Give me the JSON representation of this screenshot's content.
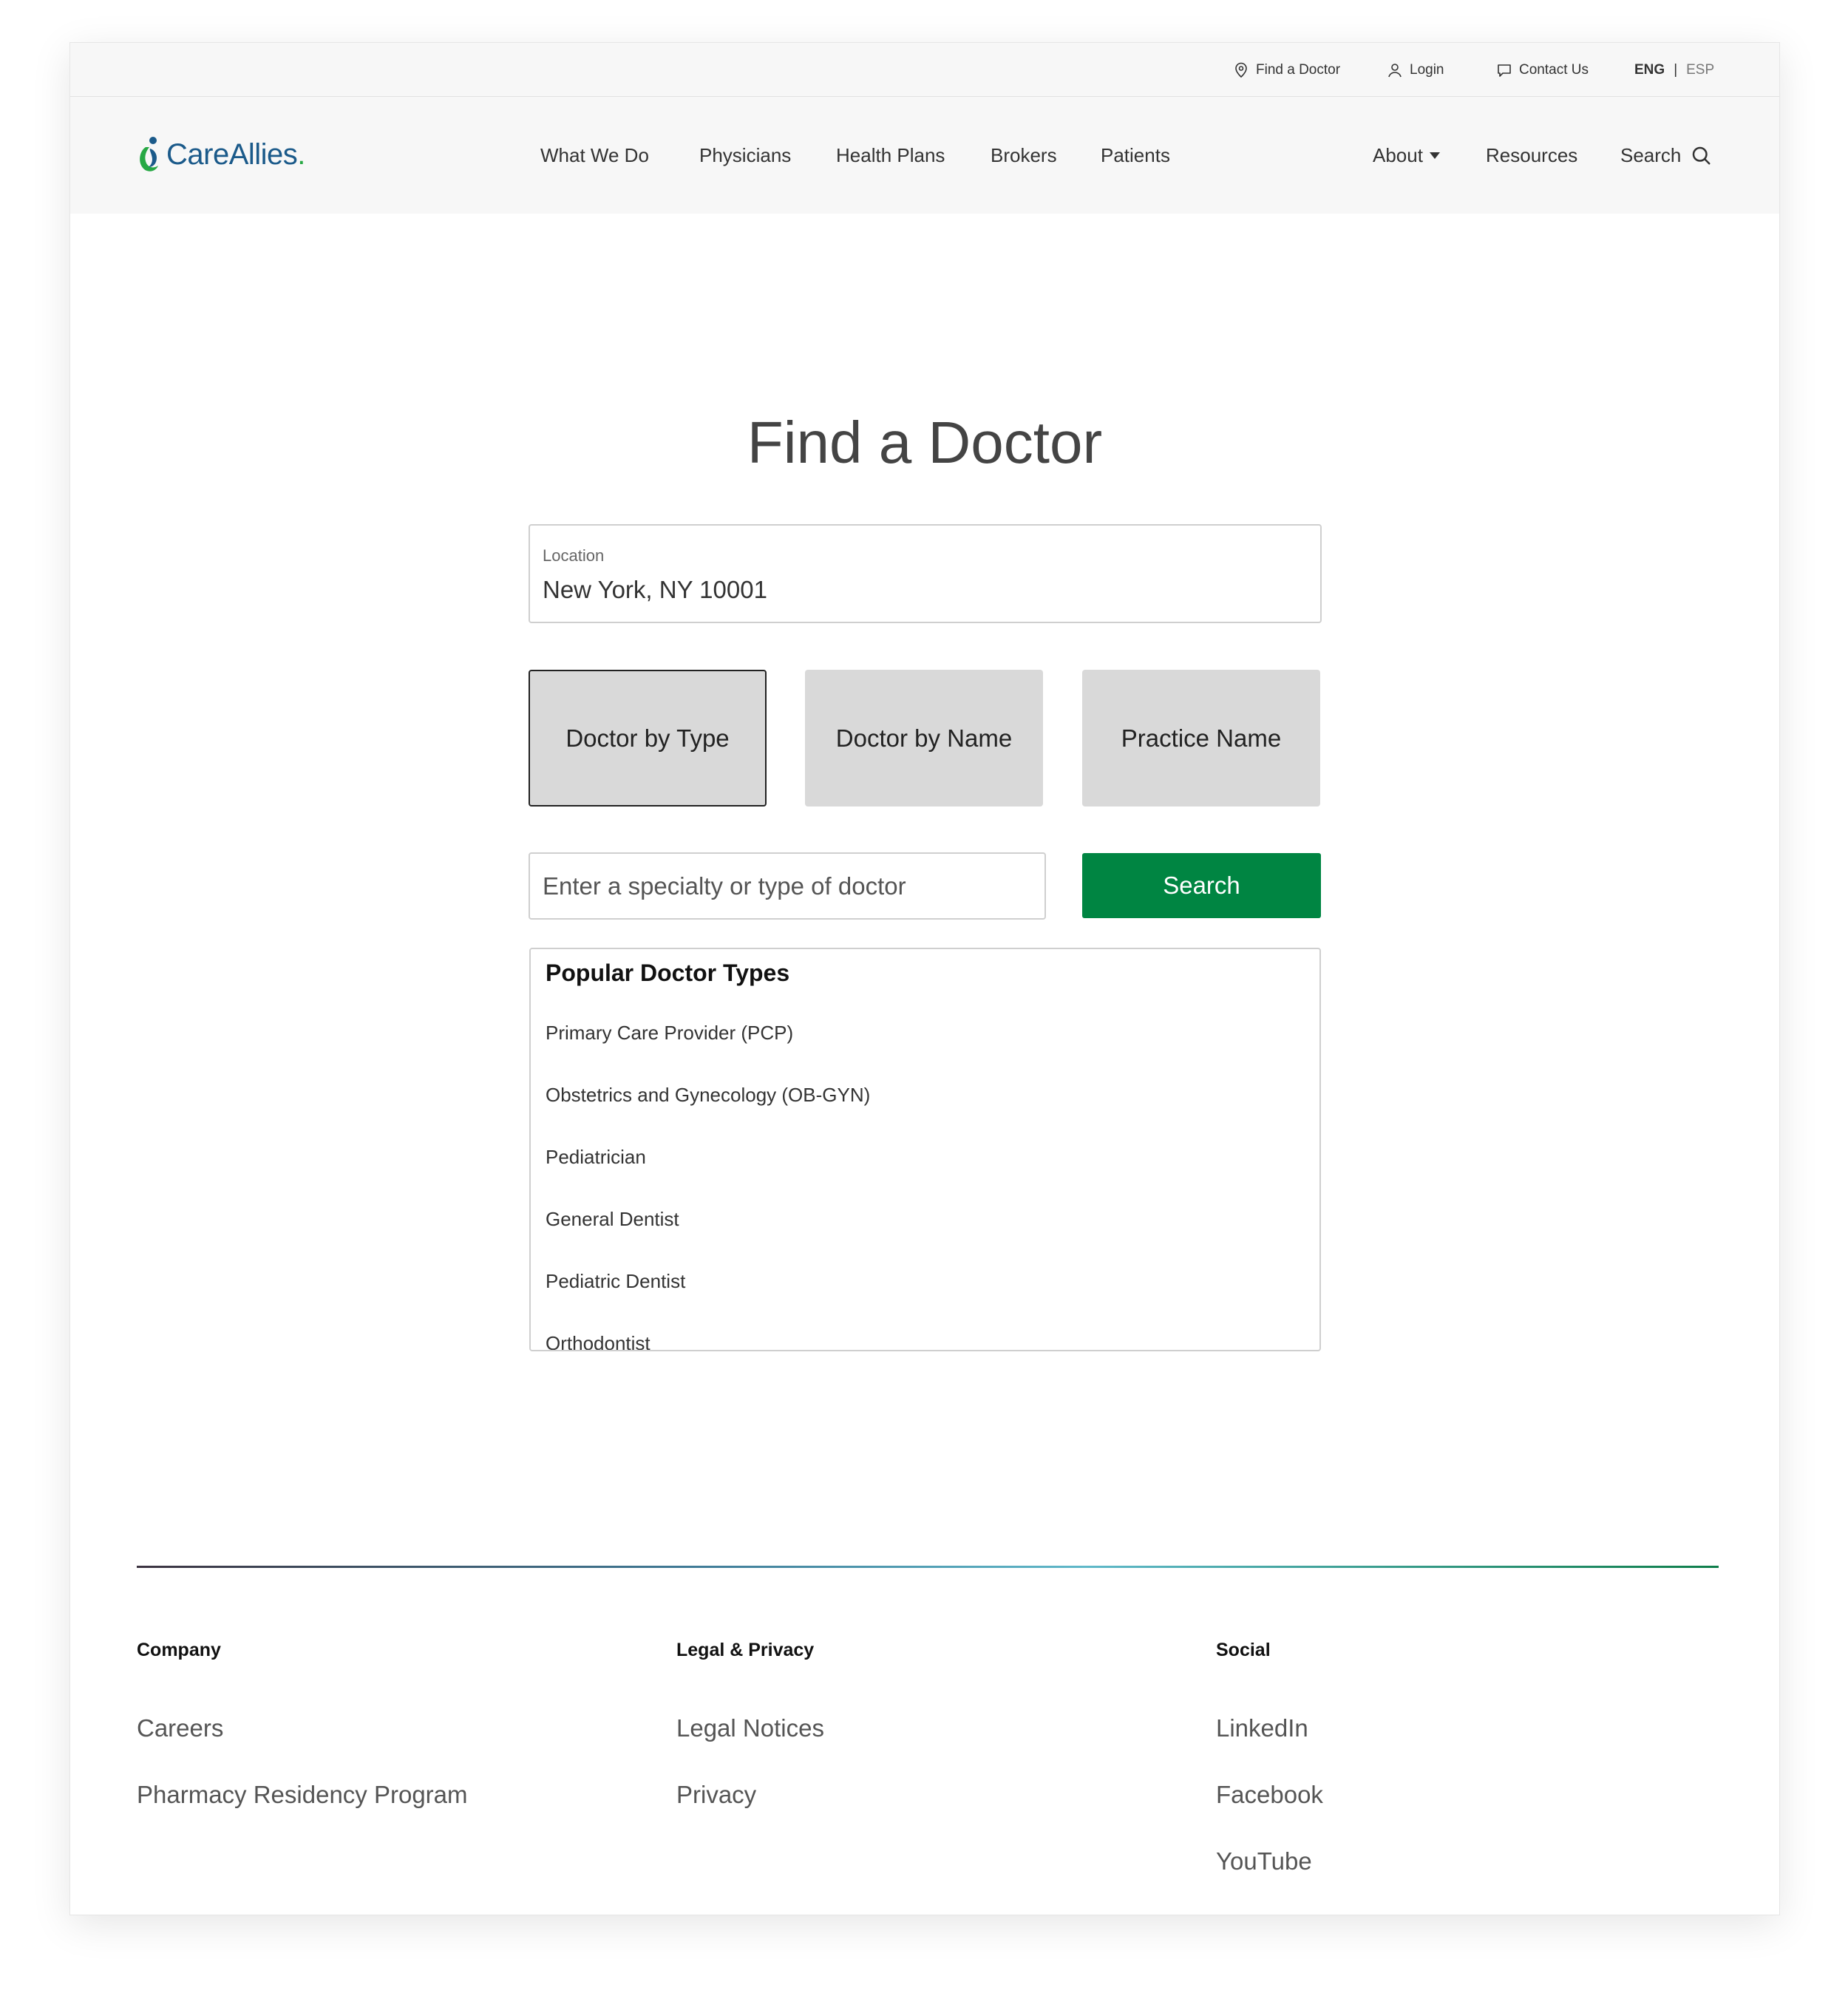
{
  "utility": {
    "find_doctor": "Find a Doctor",
    "login": "Login",
    "contact": "Contact Us",
    "lang_active": "ENG",
    "lang_sep": "|",
    "lang_other": "ESP"
  },
  "brand": {
    "name": "CareAllies",
    "dot": "."
  },
  "nav": {
    "items": [
      "What We Do",
      "Physicians",
      "Health Plans",
      "Brokers",
      "Patients"
    ],
    "about": "About",
    "resources": "Resources",
    "search": "Search"
  },
  "main": {
    "title": "Find a Doctor",
    "location_label": "Location",
    "location_value": "New York, NY 10001",
    "options": [
      "Doctor by Type",
      "Doctor by Name",
      "Practice Name"
    ],
    "query_placeholder": "Enter a specialty or type of doctor",
    "search_button": "Search",
    "popular_title": "Popular Doctor Types",
    "popular_items": [
      "Primary Care Provider (PCP)",
      "Obstetrics and Gynecology (OB-GYN)",
      "Pediatrician",
      "General Dentist",
      "Pediatric Dentist",
      "Orthodontist"
    ]
  },
  "footer": {
    "company_heading": "Company",
    "company_links": [
      "Careers",
      "Pharmacy Residency Program"
    ],
    "legal_heading": "Legal & Privacy",
    "legal_links": [
      "Legal Notices",
      "Privacy"
    ],
    "social_heading": "Social",
    "social_links": [
      "LinkedIn",
      "Facebook",
      "YouTube"
    ]
  },
  "colors": {
    "primary_green": "#008542",
    "brand_blue": "#1b5a8a",
    "option_bg": "#d9d9d9"
  }
}
